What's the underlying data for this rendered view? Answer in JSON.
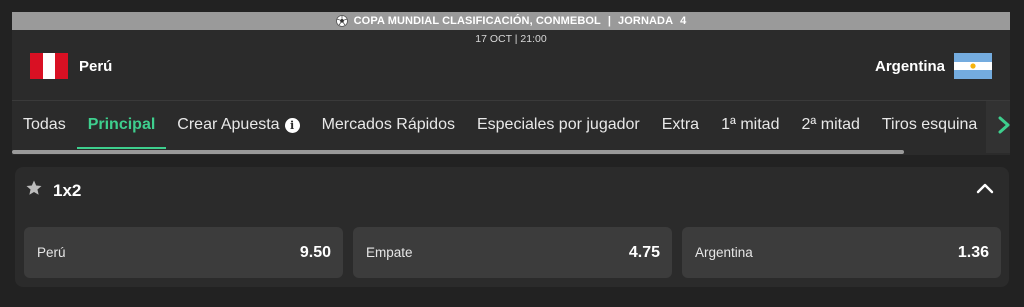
{
  "event": {
    "competition": "COPA MUNDIAL CLASIFICACIÓN, CONMEBOL",
    "separator": "|",
    "round": "JORNADA",
    "round_number": "4",
    "datetime": "17 OCT | 21:00",
    "home": {
      "name": "Perú",
      "flag_colors": [
        "#d91023",
        "#ffffff",
        "#d91023"
      ]
    },
    "away": {
      "name": "Argentina",
      "flag_colors": [
        "#74acdf",
        "#ffffff",
        "#74acdf"
      ]
    }
  },
  "tabs": [
    {
      "label": "Todas",
      "active": false
    },
    {
      "label": "Principal",
      "active": true
    },
    {
      "label": "Crear Apuesta",
      "active": false,
      "icon": "info-icon"
    },
    {
      "label": "Mercados Rápidos",
      "active": false
    },
    {
      "label": "Especiales por jugador",
      "active": false
    },
    {
      "label": "Extra",
      "active": false
    },
    {
      "label": "1ª mitad",
      "active": false
    },
    {
      "label": "2ª mitad",
      "active": false
    },
    {
      "label": "Tiros esquina",
      "active": false
    }
  ],
  "market": {
    "title": "1x2",
    "outcomes": [
      {
        "label": "Perú",
        "odd": "9.50"
      },
      {
        "label": "Empate",
        "odd": "4.75"
      },
      {
        "label": "Argentina",
        "odd": "1.36"
      }
    ]
  },
  "colors": {
    "accent": "#3ecf8e",
    "background": "#222222",
    "panel": "#2b2b2b",
    "button": "#3c3c3c"
  }
}
